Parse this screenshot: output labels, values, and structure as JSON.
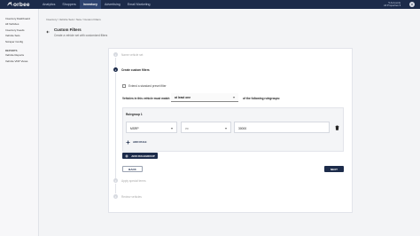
{
  "brand": {
    "name": "orbee"
  },
  "nav": {
    "items": [
      {
        "label": "Analytics",
        "active": false
      },
      {
        "label": "Shoppers",
        "active": false
      },
      {
        "label": "Inventory",
        "active": true
      },
      {
        "label": "Advertising",
        "active": false
      },
      {
        "label": "Email Marketing",
        "active": false
      }
    ]
  },
  "account": {
    "line1": "5 Accounts",
    "line2": "All Properties ▾",
    "avatar": "U"
  },
  "sidebar": {
    "items": [
      "Inventory Dashboard",
      "All Vehicles",
      "Inventory Feeds",
      "Vehicle Sets",
      "Scraper Config"
    ],
    "section": "REPORTS",
    "report_items": [
      "Vehicle Reports",
      "Vehicle VDP Views"
    ]
  },
  "breadcrumb": "Inventory  /  Vehicle Sets  /  New  /  Custom Filters",
  "header": {
    "title": "Custom Filters",
    "subtitle": "Create a vehicle set with customized filters"
  },
  "wizard": {
    "steps": [
      {
        "num": "1",
        "label": "Name vehicle set"
      },
      {
        "num": "2",
        "label": "Create custom filters"
      },
      {
        "num": "3",
        "label": "Apply special terms"
      },
      {
        "num": "4",
        "label": "Review vehicles"
      }
    ],
    "checkbox_label": "Extend a standard preset filter",
    "match_prefix": "Vehicles in this vehicle must match",
    "match_value": "at least one",
    "match_suffix": "of the following rulegroups:",
    "rulegroup": {
      "title": "Rulegroup 1",
      "field": "MSRP",
      "operator": ">=",
      "value": "30000",
      "add_rule": "ADD RULE"
    },
    "add_rulegroup": "ADD RULEGROUP",
    "back": "BACK",
    "next": "NEXT"
  },
  "colors": {
    "navy": "#1c2b4a",
    "background": "#f3f4f6"
  }
}
